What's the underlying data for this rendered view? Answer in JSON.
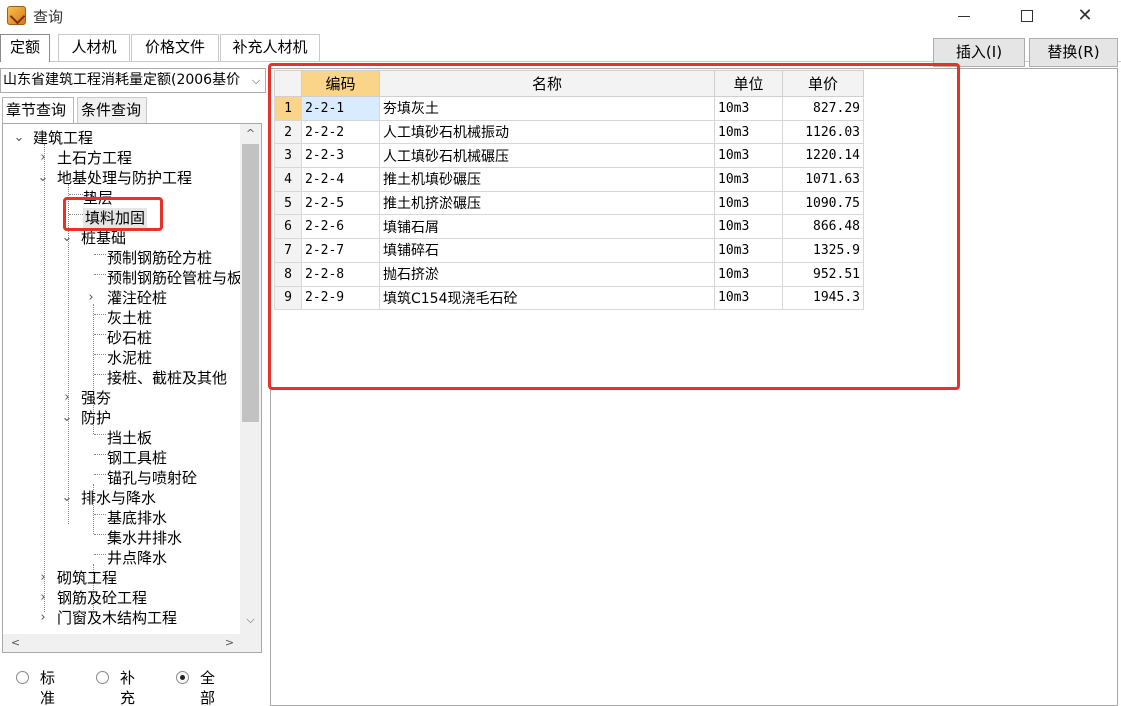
{
  "window": {
    "title": "查询",
    "min_glyph": "–",
    "max_glyph": "☐",
    "close_glyph": "✕"
  },
  "tabs": [
    {
      "label": "定额"
    },
    {
      "label": "人材机"
    },
    {
      "label": "价格文件"
    },
    {
      "label": "补充人材机"
    }
  ],
  "actions": {
    "insert_label": "插入(I)",
    "replace_label": "替换(R)"
  },
  "left": {
    "combo_value": "山东省建筑工程消耗量定额(2006基价",
    "combo_arrow": "⌵",
    "subtabs": [
      {
        "label": "章节查询"
      },
      {
        "label": "条件查询"
      }
    ],
    "tree": [
      {
        "label": "建筑工程",
        "toggle": "⌄"
      },
      {
        "label": "土石方工程",
        "toggle": "›"
      },
      {
        "label": "地基处理与防护工程",
        "toggle": "⌄"
      },
      {
        "label": "垫层",
        "toggle": ""
      },
      {
        "label": "填料加固",
        "toggle": ""
      },
      {
        "label": "桩基础",
        "toggle": "⌄"
      },
      {
        "label": "预制钢筋砼方桩",
        "toggle": ""
      },
      {
        "label": "预制钢筋砼管桩与板",
        "toggle": ""
      },
      {
        "label": "灌注砼桩",
        "toggle": "›"
      },
      {
        "label": "灰土桩",
        "toggle": ""
      },
      {
        "label": "砂石桩",
        "toggle": ""
      },
      {
        "label": "水泥桩",
        "toggle": ""
      },
      {
        "label": "接桩、截桩及其他",
        "toggle": ""
      },
      {
        "label": "强夯",
        "toggle": "›"
      },
      {
        "label": "防护",
        "toggle": "⌄"
      },
      {
        "label": "挡土板",
        "toggle": ""
      },
      {
        "label": "钢工具桩",
        "toggle": ""
      },
      {
        "label": "锚孔与喷射砼",
        "toggle": ""
      },
      {
        "label": "排水与降水",
        "toggle": "⌄"
      },
      {
        "label": "基底排水",
        "toggle": ""
      },
      {
        "label": "集水井排水",
        "toggle": ""
      },
      {
        "label": "井点降水",
        "toggle": ""
      },
      {
        "label": "砌筑工程",
        "toggle": "›"
      },
      {
        "label": "钢筋及砼工程",
        "toggle": "›"
      },
      {
        "label": "门窗及木结构工程",
        "toggle": "›"
      }
    ],
    "scroll_up": "^",
    "scroll_down": "⌵",
    "scroll_left": "<",
    "scroll_right": ">",
    "radios": [
      {
        "label": "标准",
        "checked": false
      },
      {
        "label": "补充",
        "checked": false
      },
      {
        "label": "全部",
        "checked": true
      }
    ]
  },
  "grid": {
    "columns": [
      "编码",
      "名称",
      "单位",
      "单价"
    ],
    "rows": [
      {
        "n": "1",
        "code": "2-2-1",
        "name": "夯填灰土",
        "unit": "10m3",
        "price": "827.29"
      },
      {
        "n": "2",
        "code": "2-2-2",
        "name": "人工填砂石机械振动",
        "unit": "10m3",
        "price": "1126.03"
      },
      {
        "n": "3",
        "code": "2-2-3",
        "name": "人工填砂石机械碾压",
        "unit": "10m3",
        "price": "1220.14"
      },
      {
        "n": "4",
        "code": "2-2-4",
        "name": "推土机填砂碾压",
        "unit": "10m3",
        "price": "1071.63"
      },
      {
        "n": "5",
        "code": "2-2-5",
        "name": "推土机挤淤碾压",
        "unit": "10m3",
        "price": "1090.75"
      },
      {
        "n": "6",
        "code": "2-2-6",
        "name": "填铺石屑",
        "unit": "10m3",
        "price": "866.48"
      },
      {
        "n": "7",
        "code": "2-2-7",
        "name": "填铺碎石",
        "unit": "10m3",
        "price": "1325.9"
      },
      {
        "n": "8",
        "code": "2-2-8",
        "name": "抛石挤淤",
        "unit": "10m3",
        "price": "952.51"
      },
      {
        "n": "9",
        "code": "2-2-9",
        "name": "填筑C154现浇毛石砼",
        "unit": "10m3",
        "price": "1945.3"
      }
    ]
  },
  "colors": {
    "highlight": "#e8312b",
    "header_selected": "#f9d489",
    "cell_selected": "#d9ecff"
  }
}
